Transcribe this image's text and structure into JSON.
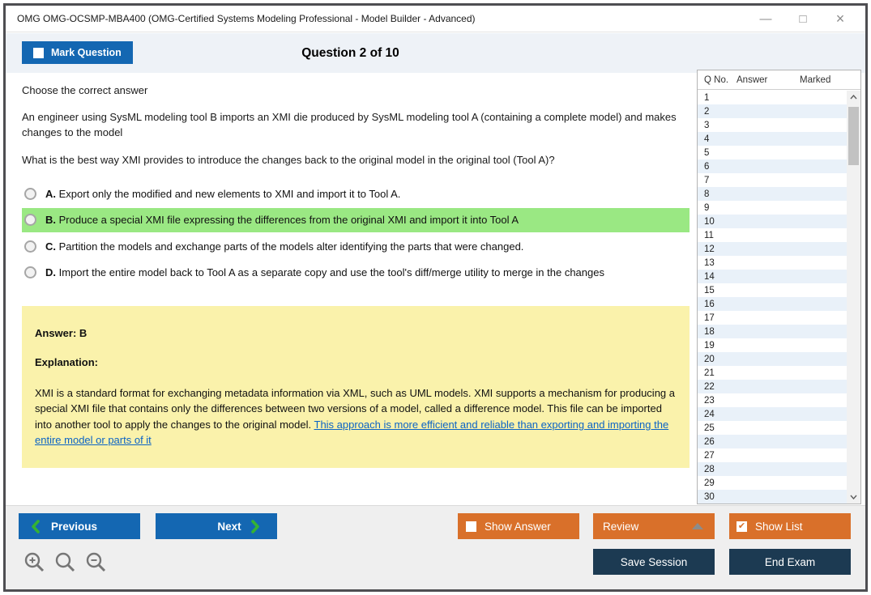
{
  "window": {
    "title": "OMG OMG-OCSMP-MBA400 (OMG-Certified Systems Modeling Professional - Model Builder - Advanced)",
    "controls": {
      "minimize": "—",
      "maximize": "□",
      "close": "×"
    }
  },
  "header": {
    "mark_question_label": "Mark Question",
    "question_counter": "Question 2 of 10"
  },
  "question": {
    "instruction": "Choose the correct answer",
    "body": "An engineer using SysML modeling tool B imports an XMI die produced by SysML modeling tool A (containing a complete model) and makes changes to the model",
    "prompt": "What is the best way XMI provides to introduce the changes back to the original model in the original tool (Tool A)?",
    "options": [
      {
        "letter": "A.",
        "text": "Export only the modified and new elements to XMI and import it to Tool A.",
        "highlighted": false
      },
      {
        "letter": "B.",
        "text": "Produce a special XMI file expressing the differences from the original XMI and import it into Tool A",
        "highlighted": true
      },
      {
        "letter": "C.",
        "text": "Partition the models and exchange parts of the models alter identifying the parts that were changed.",
        "highlighted": false
      },
      {
        "letter": "D.",
        "text": "Import the entire model back to Tool A as a separate copy and use the tool's diff/merge utility to merge in the changes",
        "highlighted": false
      }
    ]
  },
  "explanation": {
    "answer_label": "Answer: B",
    "explanation_label": "Explanation:",
    "text": "XMI is a standard format for exchanging metadata information via XML, such as UML models. XMI supports a mechanism for producing a special XMI file that contains only the differences between two versions of a model, called a difference model. This file can be imported into another tool to apply the changes to the original model. ",
    "link_text": "This approach is more efficient and reliable than exporting and importing the entire model or parts of it"
  },
  "question_list": {
    "headers": [
      "Q No.",
      "Answer",
      "Marked"
    ],
    "rows": [
      "1",
      "2",
      "3",
      "4",
      "5",
      "6",
      "7",
      "8",
      "9",
      "10",
      "11",
      "12",
      "13",
      "14",
      "15",
      "16",
      "17",
      "18",
      "19",
      "20",
      "21",
      "22",
      "23",
      "24",
      "25",
      "26",
      "27",
      "28",
      "29",
      "30"
    ]
  },
  "footer": {
    "previous_label": "Previous",
    "next_label": "Next",
    "show_answer_label": "Show Answer",
    "review_label": "Review",
    "show_list_label": "Show List",
    "save_session_label": "Save Session",
    "end_exam_label": "End Exam",
    "show_list_check": "✔"
  },
  "colors": {
    "accent_blue": "#1467b2",
    "orange": "#d9702a",
    "navy": "#1c3a52",
    "green_highlight": "#9ae883",
    "explanation_bg": "#faf2ab",
    "link_blue": "#0b63c5",
    "row_alt": "#e9f1f9",
    "chevron_green": "#35b234",
    "header_strip": "#eef2f7",
    "footer_bg": "#efefef"
  }
}
